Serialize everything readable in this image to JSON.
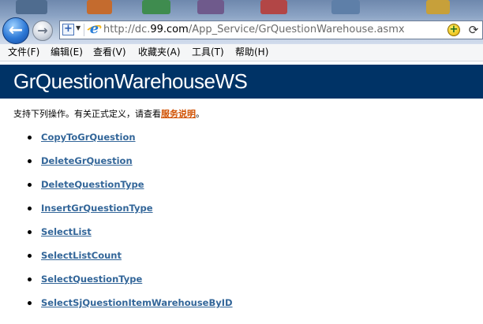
{
  "browser": {
    "url_prefix": "http://dc.",
    "url_domain": "99.com",
    "url_path": "/App_Service/GrQuestionWarehouse.asmx",
    "back_glyph": "←",
    "forward_glyph": "→",
    "compat_glyph": "+",
    "addon_glyph": "+",
    "refresh_glyph": "⟳",
    "ie_glyph": "e"
  },
  "menu": [
    "文件(F)",
    "编辑(E)",
    "查看(V)",
    "收藏夹(A)",
    "工具(T)",
    "帮助(H)"
  ],
  "page": {
    "title": "GrQuestionWarehouseWS",
    "intro_text": "支持下列操作。有关正式定义，请查看",
    "intro_link": "服务说明",
    "intro_end": "。"
  },
  "operations": [
    "CopyToGrQuestion",
    "DeleteGrQuestion",
    "DeleteQuestionType",
    "InsertGrQuestionType",
    "SelectList",
    "SelectListCount",
    "SelectQuestionType",
    "SelectSjQuestionItemWarehouseByID"
  ],
  "colors": {
    "banner": "#003366",
    "link": "#336699",
    "service_link": "#d05000"
  }
}
